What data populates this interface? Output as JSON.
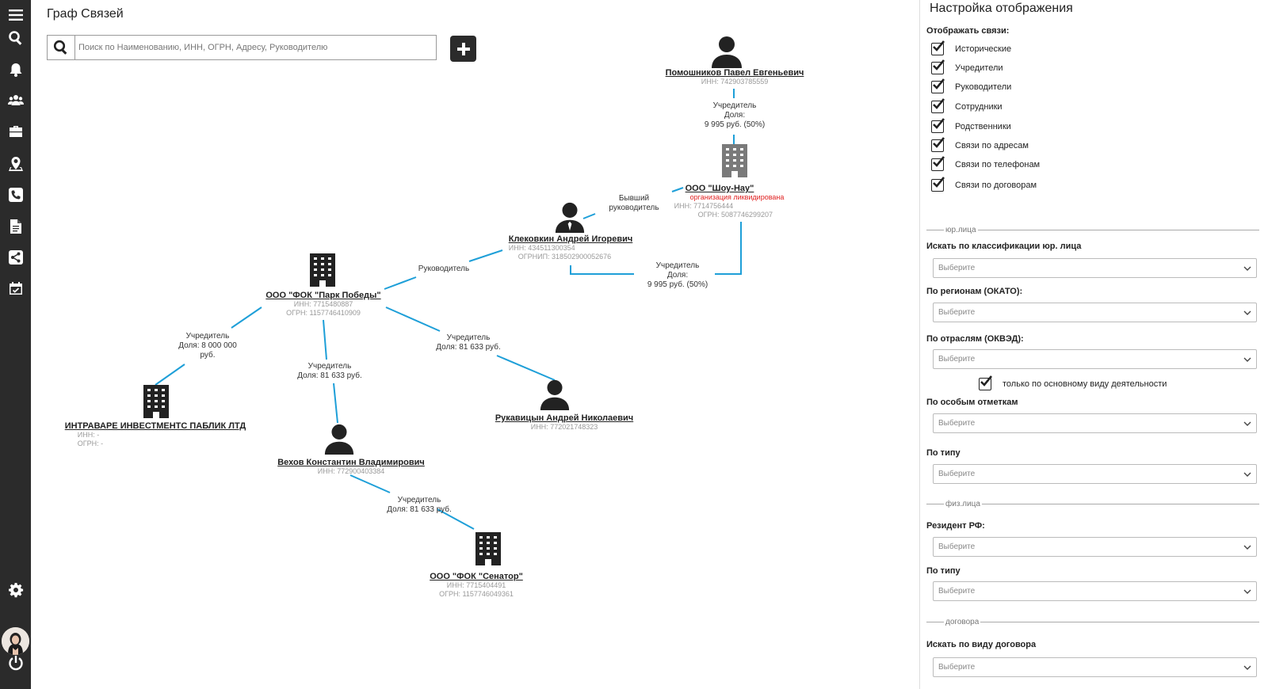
{
  "page_title": "Граф Связей",
  "search": {
    "placeholder": "Поиск по Наименованию, ИНН, ОГРН, Адресу, Руководителю"
  },
  "sidebar": {
    "icons": [
      "menu-icon",
      "search-icon",
      "bell-icon",
      "users-icon",
      "briefcase-icon",
      "map-pin-icon",
      "phone-icon",
      "document-icon",
      "share-icon",
      "calendar-check-icon",
      "gear-icon",
      "avatar",
      "power-icon"
    ]
  },
  "graph": {
    "nodes": {
      "pomoshnikov": {
        "name": "Помошников Павел Евгеньевич",
        "inn": "ИНН: 742903785559"
      },
      "shou_nau": {
        "name": "ООО \"Шоу-Нау\"",
        "status": "организация ликвидирована",
        "inn": "ИНН: 7714756444",
        "ogrn": "ОГРН: 5087746299207"
      },
      "klekovkin": {
        "name": "Клековкин Андрей Игоревич",
        "inn": "ИНН: 434511300354",
        "ogrnip": "ОГРНИП: 318502900052676"
      },
      "park_pobedy": {
        "name": "ООО \"ФОК \"Парк Победы\"",
        "inn": "ИНН: 7715480887",
        "ogrn": "ОГРН: 1157746410909"
      },
      "intravare": {
        "name": "ИНТРАВАРЕ ИНВЕСТМЕНТС ПАБЛИК ЛТД",
        "inn": "ИНН: -",
        "ogrn": "ОГРН: -"
      },
      "rukavitsyn": {
        "name": "Рукавицын Андрей Николаевич",
        "inn": "ИНН: 772021748323"
      },
      "vehov": {
        "name": "Вехов Константин Владимирович",
        "inn": "ИНН: 772900403384"
      },
      "senator": {
        "name": "ООО \"ФОК \"Сенатор\"",
        "inn": "ИНН: 7715404491",
        "ogrn": "ОГРН: 1157746049361"
      }
    },
    "edges": {
      "e1": {
        "l1": "Учредитель",
        "l2": "Доля:",
        "l3": "9 995 руб. (50%)"
      },
      "e2": {
        "l1": "Бывший",
        "l2": "руководитель"
      },
      "e3": {
        "l1": "Учредитель",
        "l2": "Доля:",
        "l3": "9 995 руб. (50%)"
      },
      "e4": {
        "l1": "Руководитель"
      },
      "e5": {
        "l1": "Учредитель",
        "l2": "Доля: 8 000 000",
        "l3": "руб."
      },
      "e6": {
        "l1": "Учредитель",
        "l2": "Доля: 81 633 руб."
      },
      "e7": {
        "l1": "Учредитель",
        "l2": "Доля: 81 633 руб."
      },
      "e8": {
        "l1": "Учредитель",
        "l2": "Доля: 81 633 руб."
      }
    }
  },
  "settings": {
    "title": "Настройка отображения",
    "links_label": "Отображать связи:",
    "checkboxes": [
      {
        "label": "Исторические",
        "checked": true
      },
      {
        "label": "Учредители",
        "checked": true
      },
      {
        "label": "Руководители",
        "checked": true
      },
      {
        "label": "Сотрудники",
        "checked": true
      },
      {
        "label": "Родственники",
        "checked": true
      },
      {
        "label": "Связи по адресам",
        "checked": true
      },
      {
        "label": "Связи по  телефонам",
        "checked": true
      },
      {
        "label": "Связи по  договорам",
        "checked": true
      }
    ],
    "section_legal": "юр.лица",
    "section_person": "физ.лица",
    "section_contract": "договора",
    "filters": {
      "classification": {
        "label": "Искать по классификации юр. лица",
        "value": "Выберите"
      },
      "regions": {
        "label": "По регионам (ОКАТО):",
        "value": "Выберите"
      },
      "industries": {
        "label": "По отраслям (ОКВЭД):",
        "value": "Выберите"
      },
      "main_activity": {
        "label": "только по основному виду деятельности",
        "checked": true
      },
      "special_marks": {
        "label": "По особым отметкам",
        "value": "Выберите"
      },
      "type_legal": {
        "label": "По типу",
        "value": "Выберите"
      },
      "resident": {
        "label": "Резидент РФ:",
        "value": "Выберите"
      },
      "type_person": {
        "label": "По типу",
        "value": "Выберите"
      },
      "contract_type": {
        "label": "Искать по виду договора",
        "value": "Выберите"
      }
    }
  }
}
